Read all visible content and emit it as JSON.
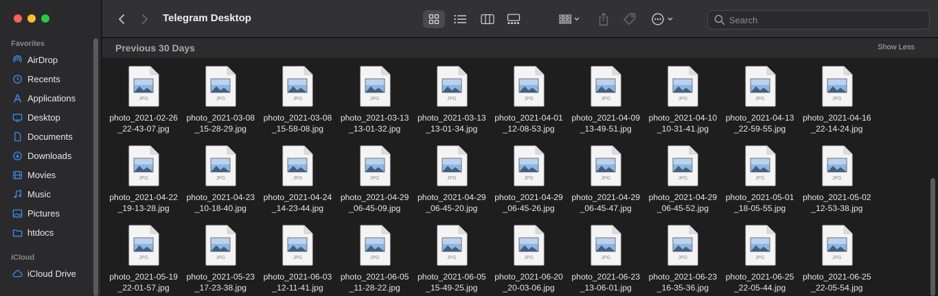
{
  "window": {
    "title": "Telegram Desktop"
  },
  "sidebar": {
    "favorites_label": "Favorites",
    "items": [
      {
        "label": "AirDrop",
        "icon": "airdrop-icon"
      },
      {
        "label": "Recents",
        "icon": "clock-icon"
      },
      {
        "label": "Applications",
        "icon": "applications-icon"
      },
      {
        "label": "Desktop",
        "icon": "desktop-icon"
      },
      {
        "label": "Documents",
        "icon": "document-icon"
      },
      {
        "label": "Downloads",
        "icon": "download-icon"
      },
      {
        "label": "Movies",
        "icon": "film-icon"
      },
      {
        "label": "Music",
        "icon": "music-note-icon"
      },
      {
        "label": "Pictures",
        "icon": "photo-icon"
      },
      {
        "label": "htdocs",
        "icon": "folder-icon"
      }
    ],
    "icloud_label": "iCloud",
    "icloud_items": [
      {
        "label": "iCloud Drive",
        "icon": "cloud-icon"
      }
    ]
  },
  "toolbar": {
    "search_placeholder": "Search",
    "views": [
      "icon-view",
      "list-view",
      "column-view",
      "gallery-view"
    ],
    "selected_view": "icon-view"
  },
  "group": {
    "title": "Previous 30 Days",
    "toggle": "Show Less"
  },
  "file_badge": "JPG",
  "files": [
    "photo_2021-02-26_22-43-07.jpg",
    "photo_2021-03-08_15-28-29.jpg",
    "photo_2021-03-08_15-58-08.jpg",
    "photo_2021-03-13_13-01-32.jpg",
    "photo_2021-03-13_13-01-34.jpg",
    "photo_2021-04-01_12-08-53.jpg",
    "photo_2021-04-09_13-49-51.jpg",
    "photo_2021-04-10_10-31-41.jpg",
    "photo_2021-04-13_22-59-55.jpg",
    "photo_2021-04-16_22-14-24.jpg",
    "photo_2021-04-22_19-13-28.jpg",
    "photo_2021-04-23_10-18-40.jpg",
    "photo_2021-04-24_14-23-44.jpg",
    "photo_2021-04-29_06-45-09.jpg",
    "photo_2021-04-29_06-45-20.jpg",
    "photo_2021-04-29_06-45-26.jpg",
    "photo_2021-04-29_06-45-47.jpg",
    "photo_2021-04-29_06-45-52.jpg",
    "photo_2021-05-01_18-05-55.jpg",
    "photo_2021-05-02_12-53-38.jpg",
    "photo_2021-05-19_22-01-57.jpg",
    "photo_2021-05-23_17-23-38.jpg",
    "photo_2021-06-03_12-11-41.jpg",
    "photo_2021-06-05_11-28-22.jpg",
    "photo_2021-06-05_15-49-25.jpg",
    "photo_2021-06-20_20-03-06.jpg",
    "photo_2021-06-23_13-06-01.jpg",
    "photo_2021-06-23_16-35-36.jpg",
    "photo_2021-06-25_22-05-44.jpg",
    "photo_2021-06-25_22-05-54.jpg"
  ],
  "colors": {
    "accent": "#3b8eea",
    "close": "#fe5f57",
    "minimize": "#febc2e",
    "maximize": "#28c840"
  }
}
